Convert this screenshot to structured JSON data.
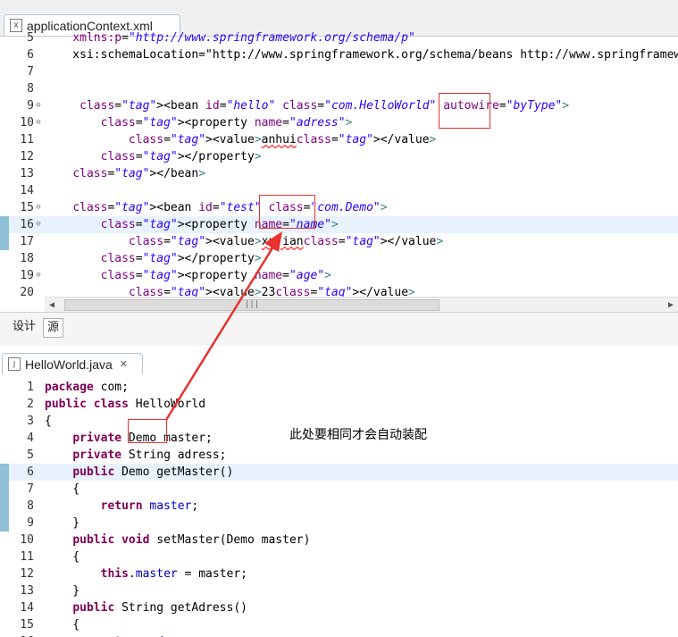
{
  "xml_tab": {
    "label": "applicationContext.xml",
    "icon": "xml-file-icon"
  },
  "java_tab": {
    "label": "HelloWorld.java",
    "icon": "java-file-icon"
  },
  "close_glyph": "✕",
  "view_tabs": [
    "设计",
    "源"
  ],
  "annotation": "此处要相同才会自动装配",
  "colors": {
    "arrow": "#e8322f",
    "box": "#e8322f",
    "current_line": "#e8f2fe",
    "marker": "#8fc0d8"
  },
  "xml_lines": [
    {
      "n": "5",
      "text": "    xmlns:p=\"http://www.springframework.org/schema/p\""
    },
    {
      "n": "6",
      "text": "    xsi:schemaLocation=\"http://www.springframework.org/schema/beans http://www.springframework"
    },
    {
      "n": "7",
      "text": ""
    },
    {
      "n": "8",
      "text": ""
    },
    {
      "n": "9",
      "text": "     <bean id=\"hello\" class=\"com.HelloWorld\" autowire=\"byType\">"
    },
    {
      "n": "10",
      "text": "        <property name=\"adress\">"
    },
    {
      "n": "11",
      "text": "            <value>anhui</value>"
    },
    {
      "n": "12",
      "text": "        </property>"
    },
    {
      "n": "13",
      "text": "    </bean>"
    },
    {
      "n": "14",
      "text": ""
    },
    {
      "n": "15",
      "text": "    <bean id=\"test\" class=\"com.Demo\">"
    },
    {
      "n": "16",
      "text": "        <property name=\"name\">"
    },
    {
      "n": "17",
      "text": "            <value>xujian</value>"
    },
    {
      "n": "18",
      "text": "        </property>"
    },
    {
      "n": "19",
      "text": "        <property name=\"age\">"
    },
    {
      "n": "20",
      "text": "            <value>23</value>"
    }
  ],
  "java_lines": [
    {
      "n": "1",
      "text": "package com;"
    },
    {
      "n": "2",
      "text": "public class HelloWorld"
    },
    {
      "n": "3",
      "text": "{"
    },
    {
      "n": "4",
      "text": "    private Demo master;"
    },
    {
      "n": "5",
      "text": "    private String adress;"
    },
    {
      "n": "6",
      "text": "    public Demo getMaster()"
    },
    {
      "n": "7",
      "text": "    {"
    },
    {
      "n": "8",
      "text": "        return master;"
    },
    {
      "n": "9",
      "text": "    }"
    },
    {
      "n": "10",
      "text": "    public void setMaster(Demo master)"
    },
    {
      "n": "11",
      "text": "    {"
    },
    {
      "n": "12",
      "text": "        this.master = master;"
    },
    {
      "n": "13",
      "text": "    }"
    },
    {
      "n": "14",
      "text": "    public String getAdress()"
    },
    {
      "n": "15",
      "text": "    {"
    },
    {
      "n": "16",
      "text": "        return adress;"
    }
  ]
}
